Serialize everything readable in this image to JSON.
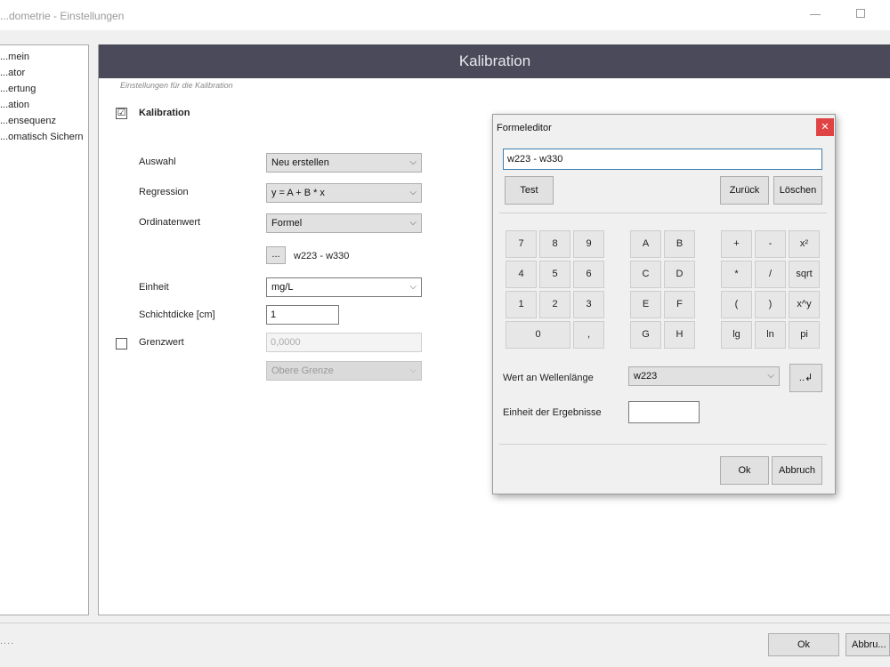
{
  "window": {
    "title": "...dometrie - Einstellungen"
  },
  "nav": {
    "items": [
      "...mein",
      "...ator",
      "...ertung",
      "...ation",
      "...ensequenz",
      "...omatisch Sichern"
    ]
  },
  "panel": {
    "header": "Kalibration",
    "subtitle": "Einstellungen für die Kalibration",
    "kalibration_label": "Kalibration",
    "kalibration_checked": "☑",
    "auswahl": {
      "label": "Auswahl",
      "value": "Neu erstellen"
    },
    "regression": {
      "label": "Regression",
      "value": "y = A + B * x"
    },
    "ordinatenwert": {
      "label": "Ordinatenwert",
      "value": "Formel"
    },
    "formula_button": "...",
    "formula_text": "w223 - w330",
    "einheit": {
      "label": "Einheit",
      "value": "mg/L"
    },
    "schichtdicke": {
      "label": "Schichtdicke [cm]",
      "value": "1"
    },
    "grenzwert": {
      "label": "Grenzwert",
      "value": "0,0000",
      "select": "Obere Grenze"
    }
  },
  "dialog": {
    "title": "Formeleditor",
    "close_icon": "close-icon",
    "formula": "w223 - w330",
    "test": "Test",
    "zurueck": "Zurück",
    "loeschen": "Löschen",
    "digits": [
      "7",
      "8",
      "9",
      "4",
      "5",
      "6",
      "1",
      "2",
      "3",
      "0",
      ","
    ],
    "letters": [
      "A",
      "B",
      "C",
      "D",
      "E",
      "F",
      "G",
      "H"
    ],
    "operators": [
      "+",
      "-",
      "x²",
      "*",
      "/",
      "sqrt",
      "(",
      ")",
      "x^y",
      "lg",
      "ln",
      "pi"
    ],
    "wert_label": "Wert an Wellenlänge",
    "wert_value": "w223",
    "insert_button": "..↲",
    "einheit_label": "Einheit der Ergebnisse",
    "einheit_value": "",
    "ok": "Ok",
    "abbruch": "Abbruch"
  },
  "footer": {
    "dots": "....",
    "ok": "Ok",
    "abbruch": "Abbru..."
  }
}
